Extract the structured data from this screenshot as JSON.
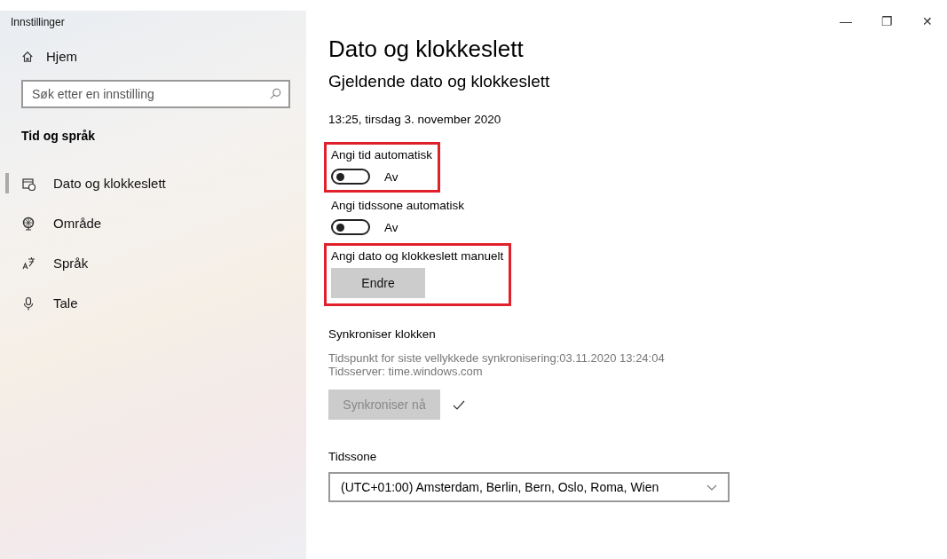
{
  "window": {
    "title": "Innstillinger",
    "controls": [
      "—",
      "❐",
      "✕"
    ]
  },
  "sidebar": {
    "home": "Hjem",
    "search": {
      "placeholder": "Søk etter en innstilling"
    },
    "section": "Tid og språk",
    "items": [
      {
        "label": "Dato og klokkeslett",
        "selected": true
      },
      {
        "label": "Område",
        "selected": false
      },
      {
        "label": "Språk",
        "selected": false
      },
      {
        "label": "Tale",
        "selected": false
      }
    ]
  },
  "content": {
    "title": "Dato og klokkeslett",
    "subtitle": "Gjeldende dato og klokkeslett",
    "current": "13:25, tirsdag 3. november 2020",
    "settings": [
      {
        "kind": "toggle",
        "label": "Angi tid automatisk",
        "on": false,
        "state": "Av",
        "highlighted": true
      },
      {
        "kind": "toggle",
        "label": "Angi tidssone automatisk",
        "on": false,
        "state": "Av",
        "highlighted": false
      },
      {
        "kind": "button",
        "label": "Angi dato og klokkeslett manuelt",
        "button": "Endre",
        "highlighted": true
      }
    ],
    "sync": {
      "heading": "Synkroniser klokken",
      "lines": [
        "Tidspunkt for siste vellykkede synkronisering:03.11.2020 13:24:04",
        "Tidsserver: time.windows.com"
      ],
      "button": "Synkroniser nå",
      "disabled": true,
      "done": true
    },
    "timezone": {
      "label": "Tidssone",
      "value": "(UTC+01:00) Amsterdam, Berlin, Bern, Oslo, Roma, Wien"
    }
  }
}
